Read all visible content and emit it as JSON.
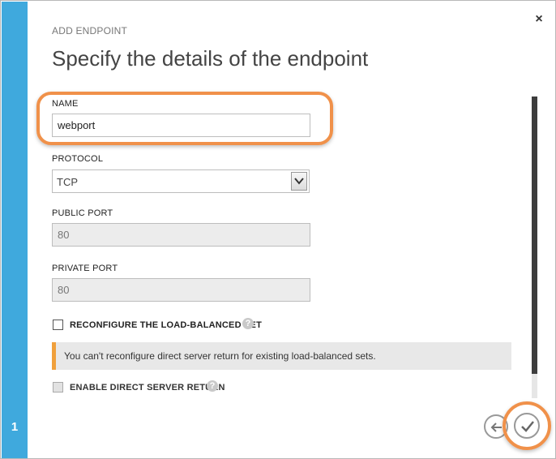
{
  "step": {
    "number": "1"
  },
  "header": {
    "kicker": "ADD ENDPOINT",
    "title": "Specify the details of the endpoint",
    "close_icon": "close-icon",
    "close_glyph": "×"
  },
  "form": {
    "name": {
      "label": "NAME",
      "value": "webport"
    },
    "protocol": {
      "label": "PROTOCOL",
      "value": "TCP"
    },
    "public_port": {
      "label": "PUBLIC PORT",
      "value": "80"
    },
    "private_port": {
      "label": "PRIVATE PORT",
      "value": "80"
    },
    "reconfigure": {
      "label": "RECONFIGURE THE LOAD-BALANCED SET",
      "checked": false,
      "help_glyph": "?"
    },
    "notice": {
      "text": "You can't reconfigure direct server return for existing load-balanced sets."
    },
    "direct_return": {
      "label": "ENABLE DIRECT SERVER RETURN",
      "checked": false,
      "disabled": true,
      "help_glyph": "?"
    }
  },
  "footer": {
    "back_icon": "back-arrow-icon",
    "complete_icon": "checkmark-icon"
  },
  "colors": {
    "accent": "#3fa9dd",
    "highlight": "#f0914a",
    "notice_bar": "#f0a03c"
  }
}
